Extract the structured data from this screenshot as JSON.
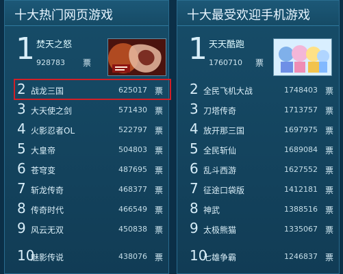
{
  "left_panel": {
    "title": "十大热门网页游戏",
    "top": {
      "rank": "1",
      "name": "焚天之怒",
      "votes": "928783",
      "unit": "票"
    },
    "items": [
      {
        "rank": "2",
        "name": "战龙三国",
        "votes": "625017",
        "unit": "票"
      },
      {
        "rank": "3",
        "name": "大天使之剑",
        "votes": "571430",
        "unit": "票"
      },
      {
        "rank": "4",
        "name": "火影忍者OL",
        "votes": "522797",
        "unit": "票"
      },
      {
        "rank": "5",
        "name": "大皇帝",
        "votes": "504803",
        "unit": "票"
      },
      {
        "rank": "6",
        "name": "苍穹变",
        "votes": "487695",
        "unit": "票"
      },
      {
        "rank": "7",
        "name": "斩龙传奇",
        "votes": "468377",
        "unit": "票"
      },
      {
        "rank": "8",
        "name": "传奇时代",
        "votes": "466549",
        "unit": "票"
      },
      {
        "rank": "9",
        "name": "风云无双",
        "votes": "450838",
        "unit": "票"
      },
      {
        "rank": "10",
        "name": "魅影传说",
        "votes": "438076",
        "unit": "票"
      }
    ]
  },
  "right_panel": {
    "title": "十大最受欢迎手机游戏",
    "top": {
      "rank": "1",
      "name": "天天酷跑",
      "votes": "1760710",
      "unit": "票"
    },
    "items": [
      {
        "rank": "2",
        "name": "全民飞机大战",
        "votes": "1748403",
        "unit": "票"
      },
      {
        "rank": "3",
        "name": "刀塔传奇",
        "votes": "1713757",
        "unit": "票"
      },
      {
        "rank": "4",
        "name": "放开那三国",
        "votes": "1697975",
        "unit": "票"
      },
      {
        "rank": "5",
        "name": "全民斩仙",
        "votes": "1689084",
        "unit": "票"
      },
      {
        "rank": "6",
        "name": "乱斗西游",
        "votes": "1627552",
        "unit": "票"
      },
      {
        "rank": "7",
        "name": "征途口袋版",
        "votes": "1412181",
        "unit": "票"
      },
      {
        "rank": "8",
        "name": "神武",
        "votes": "1388516",
        "unit": "票"
      },
      {
        "rank": "9",
        "name": "太极熊猫",
        "votes": "1335067",
        "unit": "票"
      },
      {
        "rank": "10",
        "name": "七雄争霸",
        "votes": "1246837",
        "unit": "票"
      }
    ]
  },
  "colors": {
    "background": "#0b2f47",
    "panel": "#174d69",
    "highlight": "#d21f27",
    "text": "#dbeff8"
  }
}
